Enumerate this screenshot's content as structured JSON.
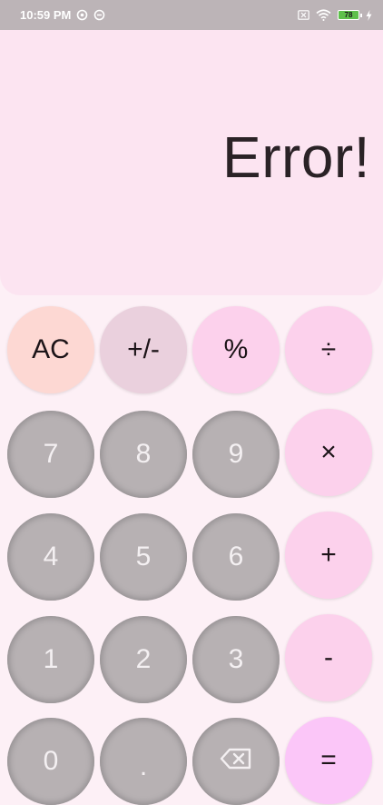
{
  "status_bar": {
    "time": "10:59 PM",
    "left_icons": [
      "sync-icon",
      "sync-icon"
    ],
    "right_icons": [
      "no-sim-icon",
      "wifi-icon",
      "battery-icon",
      "charging-bolt-icon"
    ],
    "battery_level": "78"
  },
  "display": {
    "text": "Error!"
  },
  "keys": {
    "row1": {
      "ac": "AC",
      "plus_minus": "+/-",
      "percent": "%",
      "divide": "÷"
    },
    "row2": {
      "seven": "7",
      "eight": "8",
      "nine": "9",
      "multiply": "×"
    },
    "row3": {
      "four": "4",
      "five": "5",
      "six": "6",
      "plus": "+"
    },
    "row4": {
      "one": "1",
      "two": "2",
      "three": "3",
      "minus": "-"
    },
    "row5": {
      "zero": "0",
      "dot": ".",
      "backspace": "backspace-icon",
      "equals": "="
    }
  },
  "colors": {
    "display_bg": "#fce4f1",
    "number_key": "#b7b1b3",
    "operator_key": "#fcd1ec",
    "clear_key": "#fdd8d3",
    "equals_key": "#fbc6f8"
  }
}
